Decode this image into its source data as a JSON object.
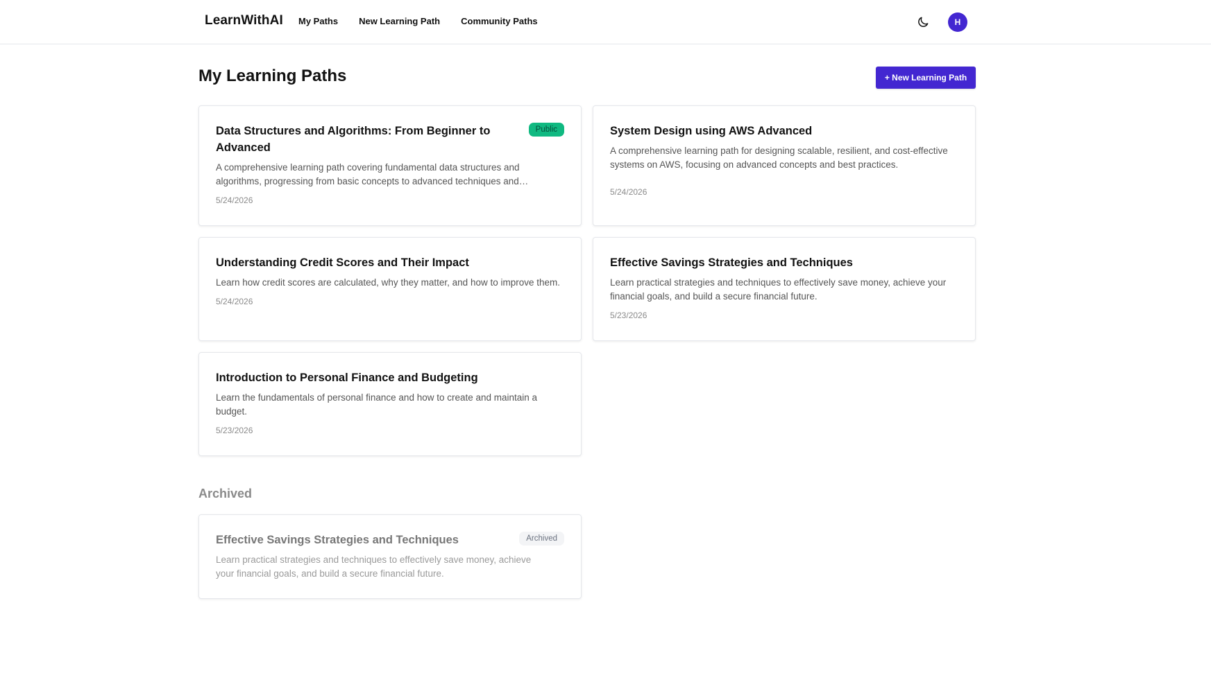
{
  "colors": {
    "accent": "#4327d1",
    "public_badge": "#10b981"
  },
  "header": {
    "brand": "LearnWithAI",
    "nav": [
      {
        "label": "My Paths"
      },
      {
        "label": "New Learning Path"
      },
      {
        "label": "Community Paths"
      }
    ],
    "theme_icon": "moon-icon",
    "avatar_initial": "H"
  },
  "main": {
    "title": "My Learning Paths",
    "new_button_label": "+ New Learning Path",
    "paths": [
      {
        "title": "Data Structures and Algorithms: From Beginner to Advanced",
        "description": "A comprehensive learning path covering fundamental data structures and algorithms, progressing from basic concepts to advanced techniques and…",
        "date": "5/24/2026",
        "badge": "Public"
      },
      {
        "title": "System Design using AWS Advanced",
        "description": "A comprehensive learning path for designing scalable, resilient, and cost-effective systems on AWS, focusing on advanced concepts and best practices.",
        "date": "5/24/2026"
      },
      {
        "title": "Understanding Credit Scores and Their Impact",
        "description": "Learn how credit scores are calculated, why they matter, and how to improve them.",
        "date": "5/24/2026"
      },
      {
        "title": "Effective Savings Strategies and Techniques",
        "description": "Learn practical strategies and techniques to effectively save money, achieve your financial goals, and build a secure financial future.",
        "date": "5/23/2026"
      },
      {
        "title": "Introduction to Personal Finance and Budgeting",
        "description": "Learn the fundamentals of personal finance and how to create and maintain a budget.",
        "date": "5/23/2026"
      }
    ]
  },
  "archived": {
    "title": "Archived",
    "paths": [
      {
        "title": "Effective Savings Strategies and Techniques",
        "description": "Learn practical strategies and techniques to effectively save money, achieve your financial goals, and build a secure financial future.",
        "badge": "Archived"
      }
    ]
  }
}
